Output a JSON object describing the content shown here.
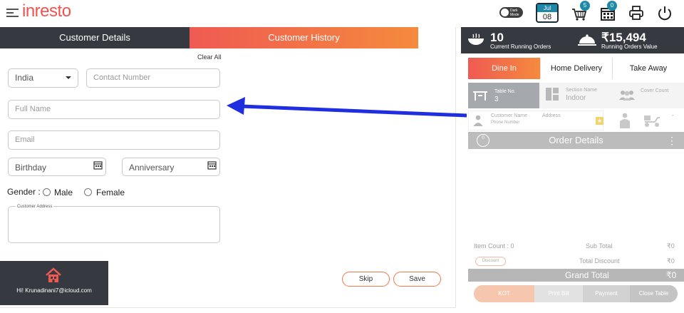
{
  "header": {
    "logo": "inresto",
    "dark_mode_label": "Dark Mode",
    "calendar_month": "Jul",
    "calendar_day": "08",
    "cart_badge": "5",
    "orders_badge": "0"
  },
  "customer": {
    "tabs": [
      "Customer Details",
      "Customer History"
    ],
    "clear_all": "Clear All",
    "country": "India",
    "contact_placeholder": "Contact Number",
    "full_name_placeholder": "Full Name",
    "email_placeholder": "Email",
    "birthday_placeholder": "Birthday",
    "anniversary_placeholder": "Anniversary",
    "gender_label": "Gender :",
    "gender_options": [
      "Male",
      "Female"
    ],
    "address_label": "Customer Address",
    "skip_label": "Skip",
    "save_label": "Save"
  },
  "user": {
    "greeting": "Hi! Krunadinani7@icloud.com"
  },
  "order_panel": {
    "running_orders_count": "10",
    "running_orders_label": "Current Running Orders",
    "running_value": "₹15,494",
    "running_value_label": "Running Orders Value",
    "order_tabs": [
      "Dine In",
      "Home Delivery",
      "Take Away"
    ],
    "table_label": "Table No.",
    "table_value": "3",
    "section_label": "Section Name",
    "section_value": "Indoor",
    "cover_label": "Cover Count",
    "customer_name_label": "Customer Name",
    "phone_label": "Phone Number",
    "address_label": "Address",
    "dash": "-",
    "item_badge": "0",
    "order_details_title": "Order Details",
    "item_count_label": "Item Count : 0",
    "sub_total_label": "Sub Total",
    "sub_total_value": "₹0",
    "discount_button": "Discount",
    "total_discount_label": "Total Discount",
    "total_discount_value": "₹0",
    "grand_total_label": "Grand Total",
    "grand_total_value": "₹0",
    "actions": [
      "KOT",
      "Print Bill",
      "Payment",
      "Close Table"
    ]
  },
  "colors": {
    "accent_start": "#ef5a52",
    "accent_end": "#f58a3d",
    "dark": "#36393f",
    "annotation_arrow": "#1f2fe0"
  }
}
